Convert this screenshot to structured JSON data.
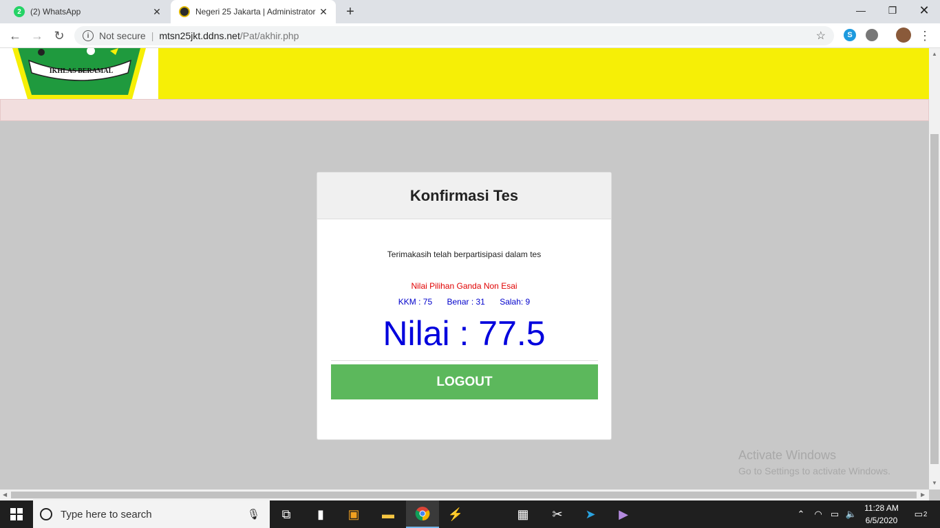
{
  "browser": {
    "tabs": [
      {
        "title": "(2) WhatsApp",
        "badge": "2"
      },
      {
        "title": "Negeri 25 Jakarta | Administrator"
      }
    ],
    "security_label": "Not secure",
    "url_domain": "mtsn25jkt.ddns.net",
    "url_path": "/Pat/akhir.php"
  },
  "page": {
    "logo_text": "IKHLAS BERAMAL",
    "card": {
      "title": "Konfirmasi Tes",
      "thanks": "Terimakasih telah berpartisipasi dalam tes",
      "subtitle": "Nilai Pilihan Ganda Non Esai",
      "kkm": "KKM : 75",
      "benar": "Benar : 31",
      "salah": "Salah: 9",
      "score": "Nilai : 77.5",
      "logout_label": "LOGOUT"
    },
    "watermark": {
      "line1": "Activate Windows",
      "line2": "Go to Settings to activate Windows."
    }
  },
  "taskbar": {
    "search_placeholder": "Type here to search",
    "time": "11:28 AM",
    "date": "6/5/2020",
    "notification_count": "2"
  },
  "colors": {
    "banner": "#f6ef06",
    "alert": "#f2dede",
    "logout": "#5cb85c",
    "score": "#0000dd",
    "subtitle": "#e00000"
  }
}
